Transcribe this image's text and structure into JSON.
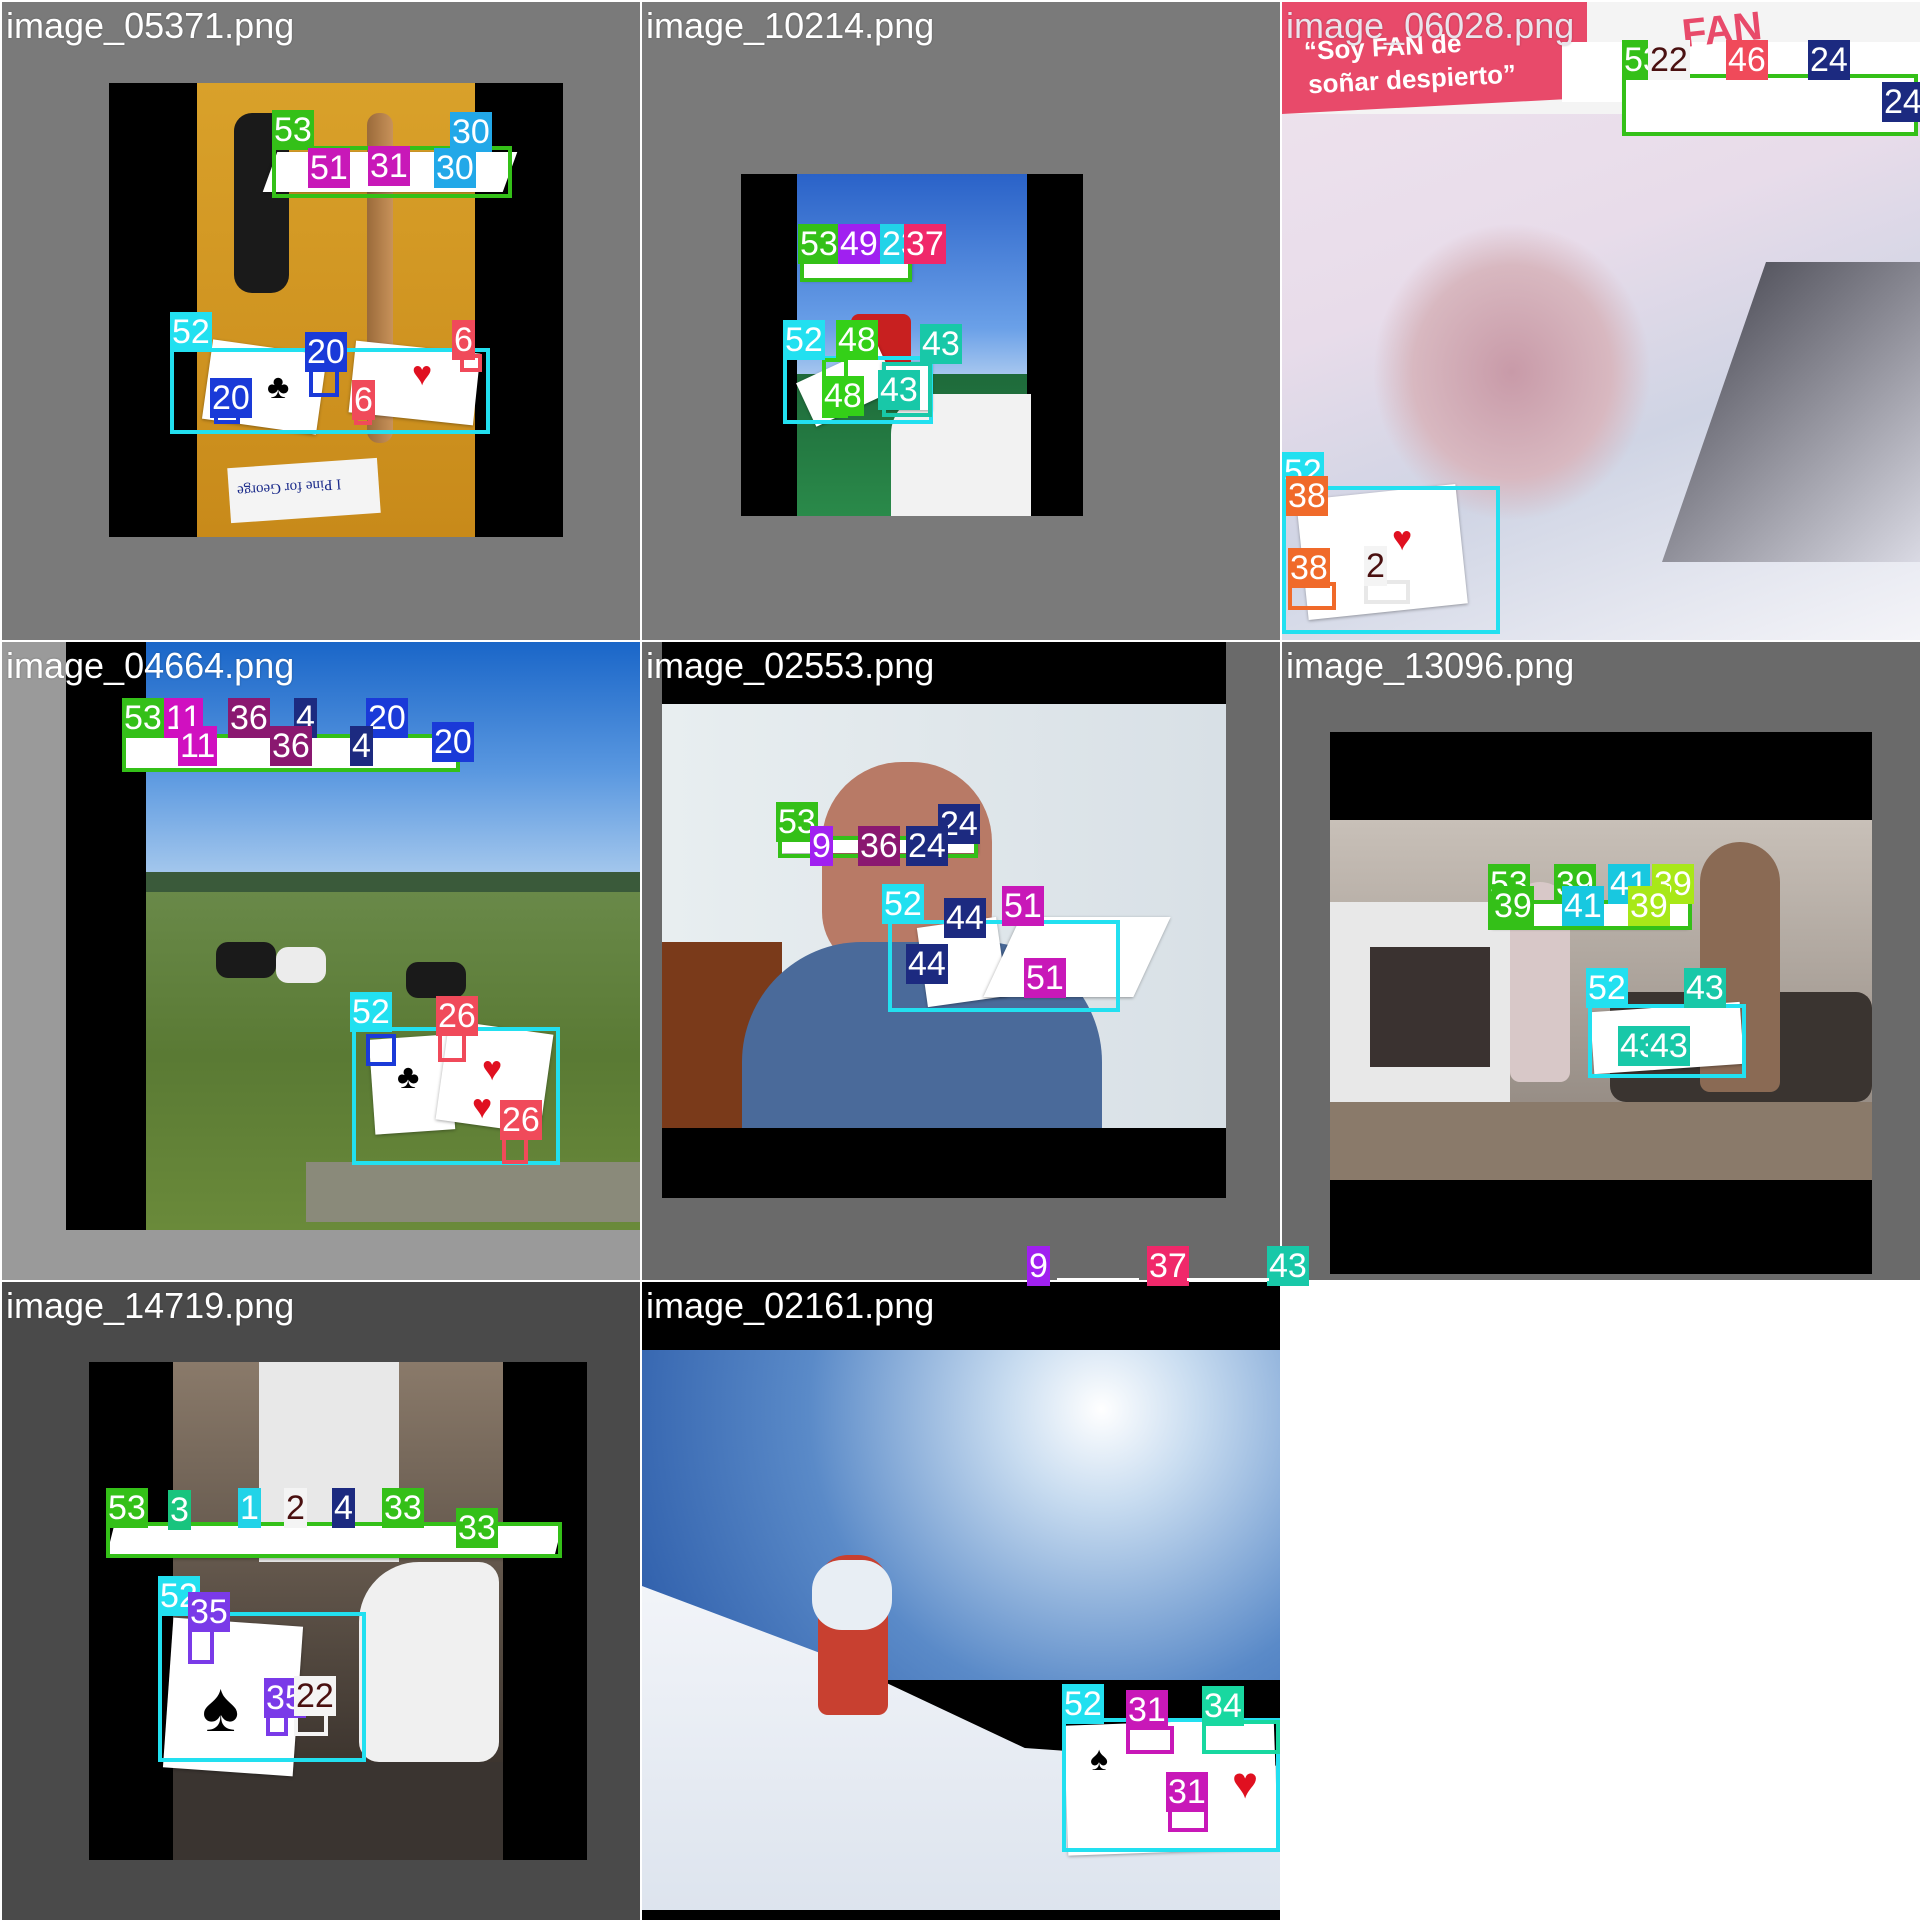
{
  "colors": {
    "c1": "#22d3e8",
    "c2": "#7a1a1a",
    "c3": "#18c47e",
    "c4": "#1c2a80",
    "c6": "#f04a5a",
    "c9": "#a020f0",
    "c11": "#d010c0",
    "c20": "#1a3ad8",
    "c22": "#7a1a1a",
    "c24": "#1c2a80",
    "c26": "#f04a5a",
    "c30": "#22a8e8",
    "c31": "#c818b8",
    "c33": "#34c018",
    "c34": "#18d8a0",
    "c35": "#7a3ae8",
    "c36": "#8a1870",
    "c37": "#f0286a",
    "c38": "#f06a2a",
    "c39": "#a8e818",
    "c41": "#18c8e0",
    "c43": "#18c8a8",
    "c44": "#1c2a80",
    "c46": "#f04a5a",
    "c48": "#34d018",
    "c49": "#a020f0",
    "c51": "#c818b8",
    "c52": "#22e0f0",
    "c53": "#34c018"
  },
  "tiles": [
    {
      "title": "image_05371.png",
      "labels": [
        "53",
        "51",
        "31",
        "30",
        "30",
        "52",
        "20",
        "20",
        "6",
        "6"
      ]
    },
    {
      "title": "image_10214.png",
      "labels": [
        "53",
        "49",
        "23",
        "37",
        "52",
        "48",
        "43",
        "48",
        "43"
      ]
    },
    {
      "title": "image_06028.png",
      "labels": [
        "53",
        "22",
        "46",
        "24",
        "24",
        "52",
        "38",
        "38",
        "2"
      ]
    },
    {
      "title": "image_04664.png",
      "labels": [
        "53",
        "11",
        "36",
        "4",
        "20",
        "11",
        "36",
        "4",
        "20",
        "52",
        "26",
        "26"
      ]
    },
    {
      "title": "image_02553.png",
      "labels": [
        "53",
        "24",
        "9",
        "36",
        "24",
        "52",
        "44",
        "51",
        "44",
        "51"
      ]
    },
    {
      "title": "image_13096.png",
      "labels": [
        "53",
        "39",
        "41",
        "39",
        "39",
        "41",
        "39",
        "52",
        "43",
        "43",
        "43"
      ]
    },
    {
      "title": "image_14719.png",
      "labels": [
        "53",
        "3",
        "1",
        "2",
        "4",
        "33",
        "33",
        "52",
        "35",
        "35",
        "22"
      ]
    },
    {
      "title": "image_02161.png",
      "labels": [
        "52",
        "31",
        "34",
        "31"
      ]
    }
  ],
  "stray_labels": [
    "9",
    "37",
    "43"
  ],
  "scene_text": {
    "sign_05371": "I Pine for George",
    "banner_06028_line1": "“Soy FAN de",
    "banner_06028_line2": "soñar despierto”",
    "banner_06028_fan": "FAN"
  }
}
